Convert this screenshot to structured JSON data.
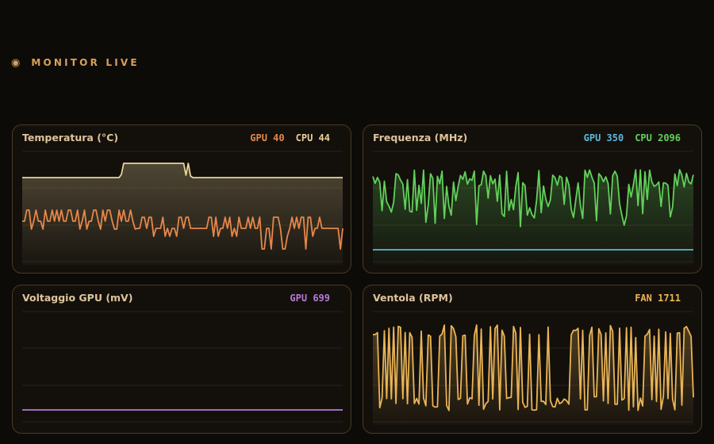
{
  "header": {
    "title": "MONITOR LIVE",
    "icon": "live-indicator-icon"
  },
  "colors": {
    "gpu_temp": "#e6874a",
    "cpu_temp": "#ead39a",
    "gpu_freq": "#5bb8d8",
    "cpu_freq": "#62d05a",
    "gpu_volt": "#b57ad6",
    "fan": "#e9b456",
    "accent": "#d9a05a"
  },
  "panels": {
    "temperature": {
      "title": "Temperatura (°C)",
      "readouts": [
        {
          "text": "GPU 40",
          "color": "#e6874a"
        },
        {
          "text": "CPU 44",
          "color": "#ead39a"
        }
      ]
    },
    "frequency": {
      "title": "Frequenza (MHz)",
      "readouts": [
        {
          "text": "GPU 350",
          "color": "#5bb8d8"
        },
        {
          "text": "CPU 2096",
          "color": "#62d05a"
        }
      ]
    },
    "voltage": {
      "title": "Voltaggio GPU (mV)",
      "readouts": [
        {
          "text": "GPU 699",
          "color": "#b57ad6"
        }
      ]
    },
    "fan": {
      "title": "Ventola (RPM)",
      "readouts": [
        {
          "text": "FAN 1711",
          "color": "#e9b456"
        }
      ]
    }
  }
}
